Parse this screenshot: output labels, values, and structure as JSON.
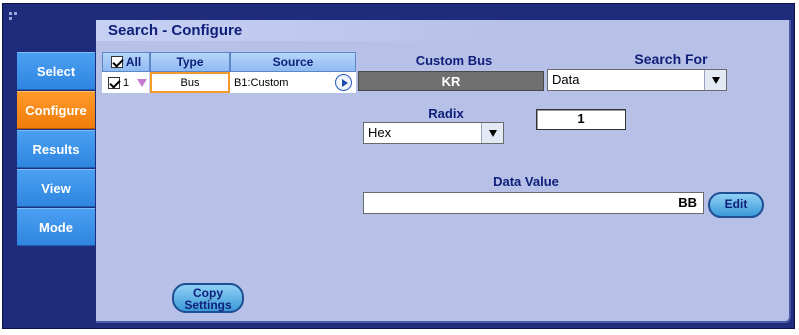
{
  "panel": {
    "title": "Search - Configure"
  },
  "sidebar": {
    "items": [
      {
        "label": "Select",
        "active": false
      },
      {
        "label": "Configure",
        "active": true
      },
      {
        "label": "Results",
        "active": false
      },
      {
        "label": "View",
        "active": false
      },
      {
        "label": "Mode",
        "active": false
      }
    ]
  },
  "table": {
    "headers": {
      "all": "All",
      "type": "Type",
      "source": "Source"
    },
    "row": {
      "index": "1",
      "type": "Bus",
      "source": "B1:Custom"
    }
  },
  "custom_bus": {
    "label": "Custom Bus",
    "value": "KR"
  },
  "search_for": {
    "label": "Search For",
    "value": "Data"
  },
  "radix": {
    "label": "Radix",
    "value": "Hex"
  },
  "count": {
    "value": "1"
  },
  "data_value": {
    "label": "Data Value",
    "value": "BB"
  },
  "buttons": {
    "edit": "Edit",
    "copy_line1": "Copy",
    "copy_line2": "Settings"
  },
  "colors": {
    "frame": "#1f2c7c",
    "panel": "#b7c0e6",
    "tab": "#2f85e0",
    "tab_active": "#f07c0a"
  }
}
